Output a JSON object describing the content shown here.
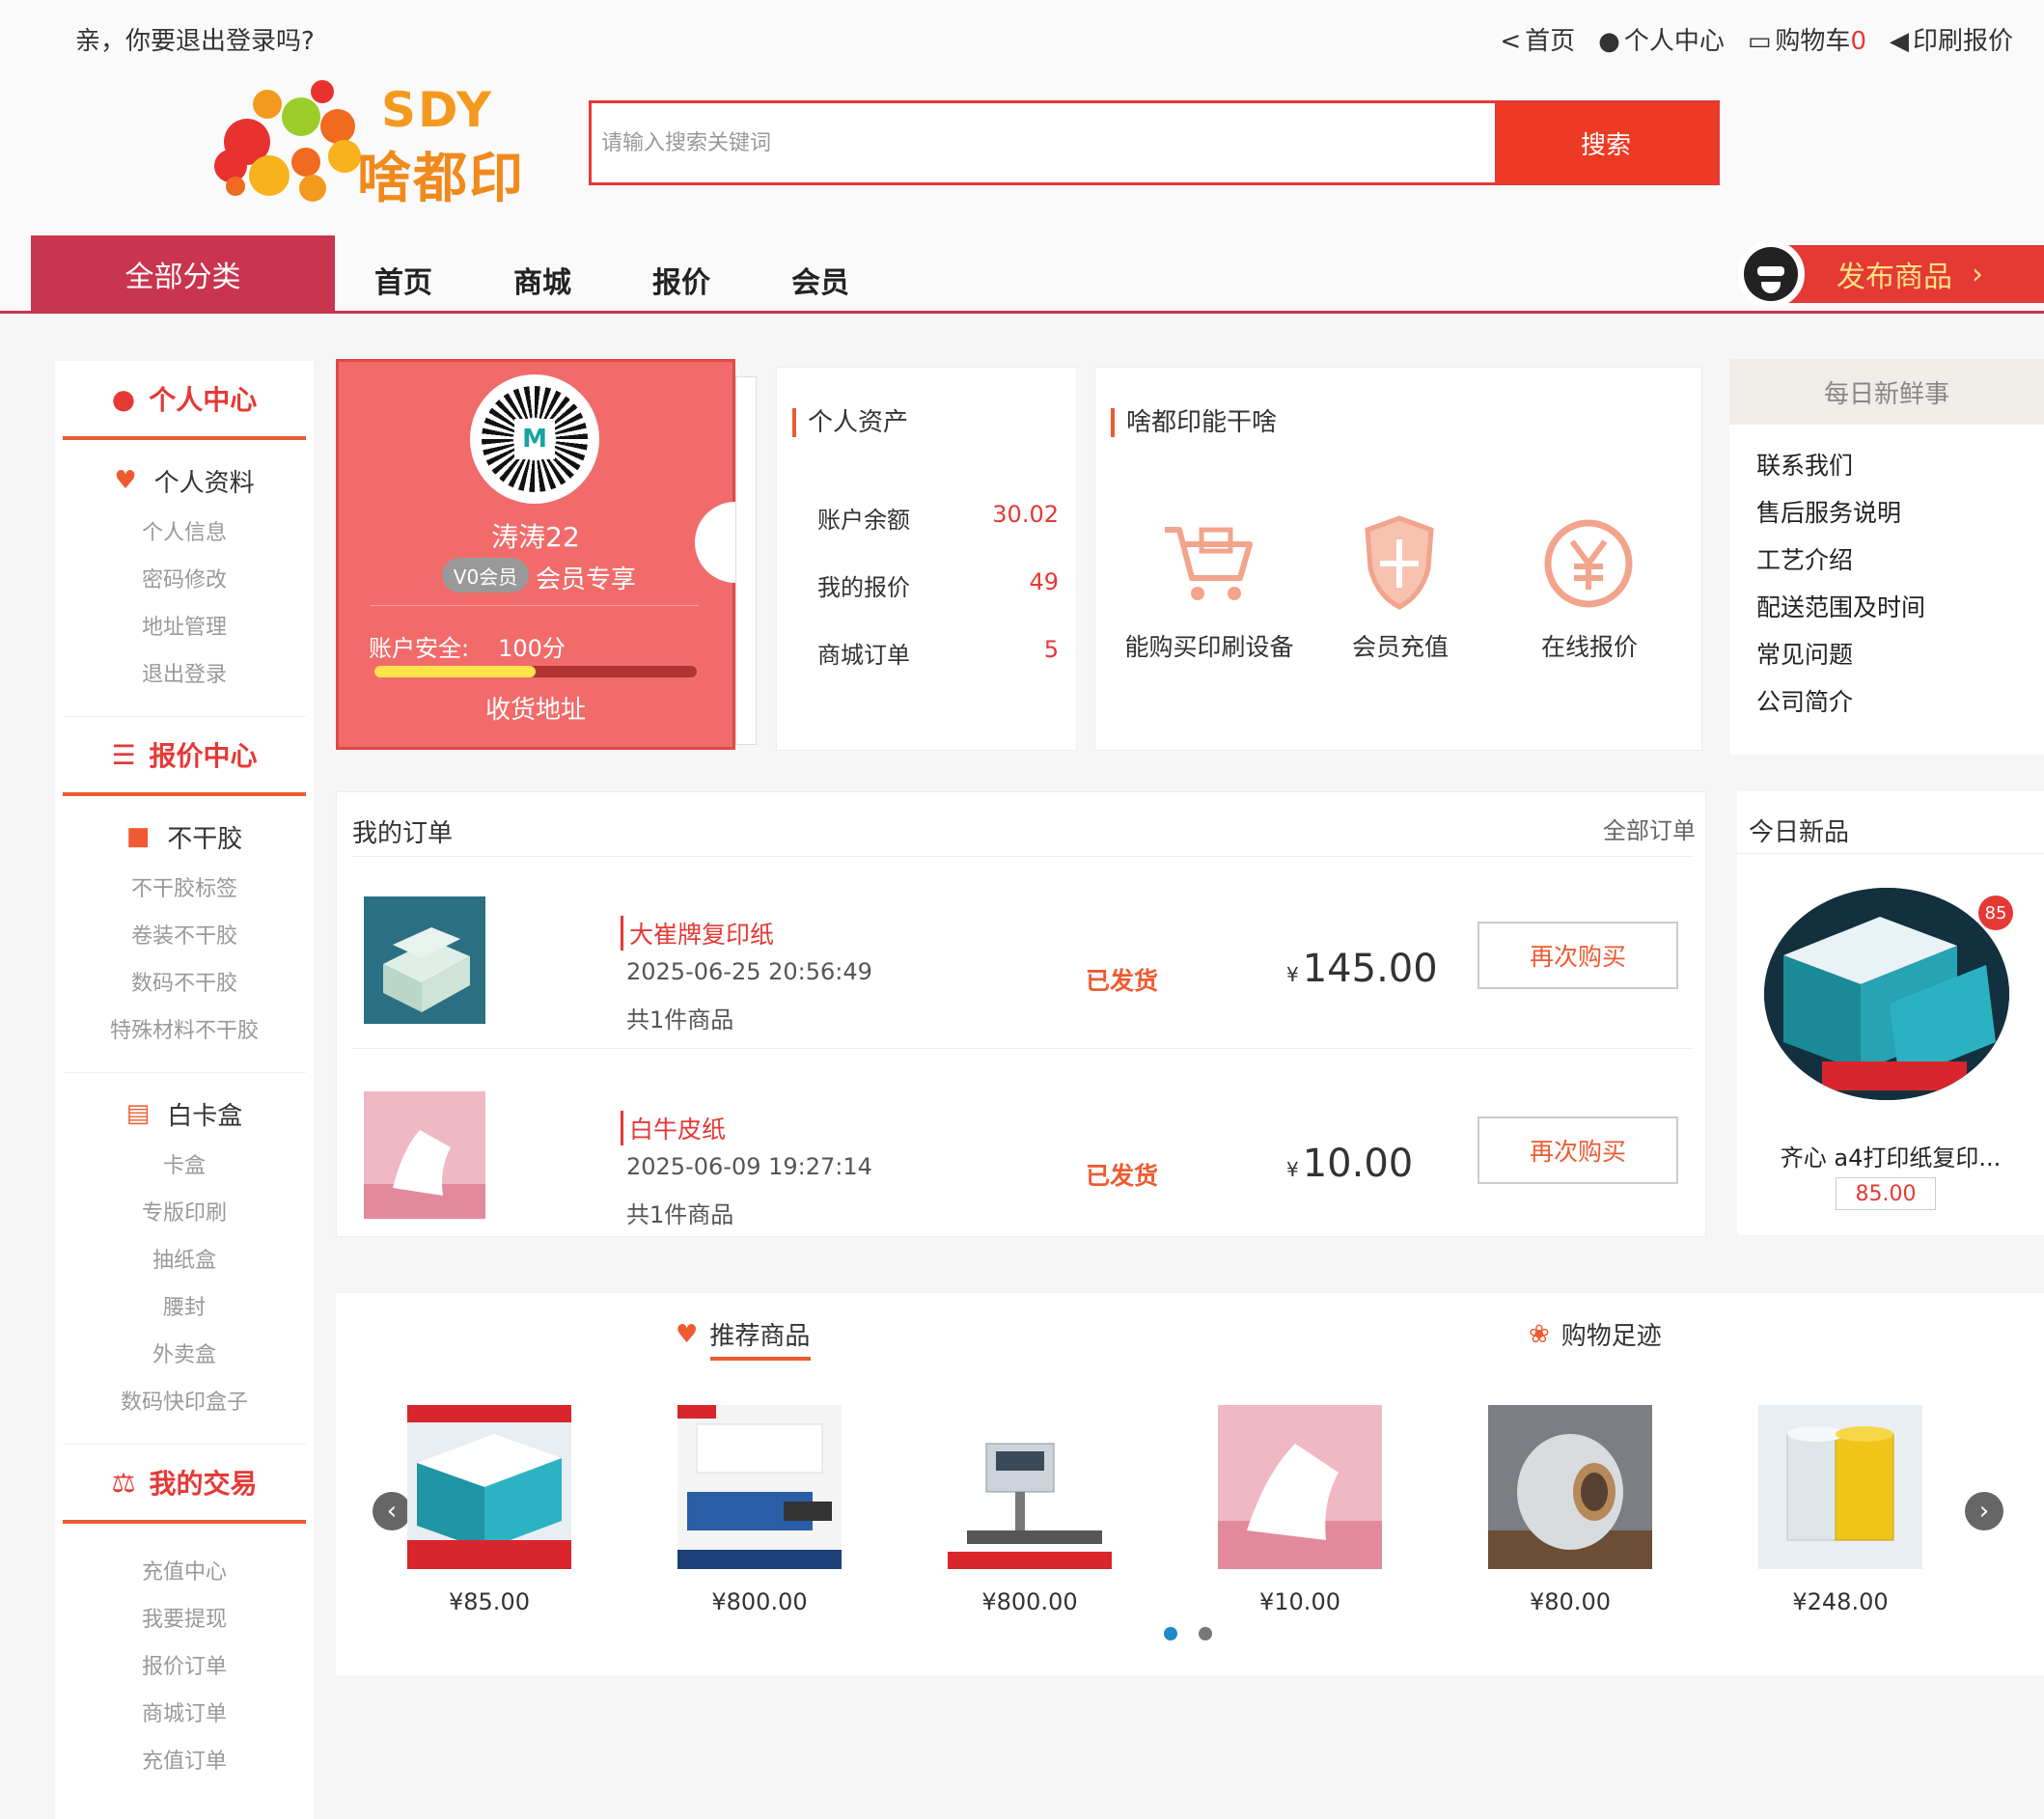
{
  "topbar": {
    "greeting": "亲，你要退出登录吗?",
    "links": [
      {
        "icon": "share-icon",
        "label": "首页"
      },
      {
        "icon": "user-icon",
        "label": "个人中心"
      },
      {
        "icon": "cart-icon",
        "label": "购物车",
        "count": "0"
      },
      {
        "icon": "speaker-icon",
        "label": "印刷报价"
      }
    ]
  },
  "logo": {
    "line1": "SDY",
    "line2": "啥都印"
  },
  "search": {
    "placeholder": "请输入搜索关键词",
    "value": "",
    "button": "搜索"
  },
  "nav": {
    "all_categories": "全部分类",
    "links": [
      "首页",
      "商城",
      "报价",
      "会员"
    ],
    "publish": "发布商品",
    "publish_arrow": "›"
  },
  "sidebar": {
    "sections": [
      {
        "title": "个人中心",
        "icon": "user-icon",
        "groups": [
          {
            "title": "个人资料",
            "icon": "heart-icon",
            "items": [
              "个人信息",
              "密码修改",
              "地址管理",
              "退出登录"
            ]
          }
        ]
      },
      {
        "title": "报价中心",
        "icon": "list-icon",
        "groups": [
          {
            "title": "不干胶",
            "icon": "truck-icon",
            "items": [
              "不干胶标签",
              "卷装不干胶",
              "数码不干胶",
              "特殊材料不干胶"
            ]
          },
          {
            "title": "白卡盒",
            "icon": "newspaper-icon",
            "items": [
              "卡盒",
              "专版印刷",
              "抽纸盒",
              "腰封",
              "外卖盒",
              "数码快印盒子"
            ]
          }
        ]
      },
      {
        "title": "我的交易",
        "icon": "scale-icon",
        "groups": [
          {
            "title": "",
            "icon": "",
            "items": [
              "充值中心",
              "我要提现",
              "报价订单",
              "商城订单",
              "充值订单"
            ]
          }
        ]
      }
    ]
  },
  "profile": {
    "username": "涛涛22",
    "vip_badge": "V0会员",
    "vip_text": "会员专享",
    "security_label": "账户安全:",
    "security_score": "100分",
    "security_level": 0.5,
    "address_link": "收货地址",
    "qr_mark": "M"
  },
  "assets": {
    "title": "个人资产",
    "rows": [
      {
        "label": "账户余额",
        "value": "30.02"
      },
      {
        "label": "我的报价",
        "value": "49"
      },
      {
        "label": "商城订单",
        "value": "5"
      }
    ]
  },
  "cando": {
    "title": "啥都印能干啥",
    "items": [
      {
        "label": "能购买印刷设备",
        "icon": "cart-icon"
      },
      {
        "label": "会员充值",
        "icon": "shield-icon"
      },
      {
        "label": "在线报价",
        "icon": "yen-icon"
      }
    ]
  },
  "fresh": {
    "title": "每日新鲜事",
    "items": [
      "联系我们",
      "售后服务说明",
      "工艺介绍",
      "配送范围及时间",
      "常见问题",
      "公司简介"
    ]
  },
  "orders": {
    "title": "我的订单",
    "all_link": "全部订单",
    "items": [
      {
        "name": "大崔牌复印纸",
        "date": "2025-06-25 20:56:49",
        "count": "共1件商品",
        "status": "已发货",
        "currency": "¥",
        "price": "145.00",
        "rebuy": "再次购买"
      },
      {
        "name": "白牛皮纸",
        "date": "2025-06-09 19:27:14",
        "count": "共1件商品",
        "status": "已发货",
        "currency": "¥",
        "price": "10.00",
        "rebuy": "再次购买"
      }
    ]
  },
  "today_new": {
    "title": "今日新品",
    "badge": "85",
    "name": "齐心 a4打印纸复印...",
    "price": "85.00"
  },
  "recommend": {
    "tab_recommend": "推荐商品",
    "tab_history": "购物足迹",
    "products": [
      {
        "price": "¥85.00"
      },
      {
        "price": "¥800.00"
      },
      {
        "price": "¥800.00"
      },
      {
        "price": "¥10.00"
      },
      {
        "price": "¥80.00"
      },
      {
        "price": "¥248.00"
      }
    ],
    "page_dots": 2,
    "active_dot": 0
  },
  "colors": {
    "brand_red": "#c9344e",
    "accent": "#e53935",
    "orange": "#ee5b32",
    "profile_bg": "#f26b6b"
  }
}
